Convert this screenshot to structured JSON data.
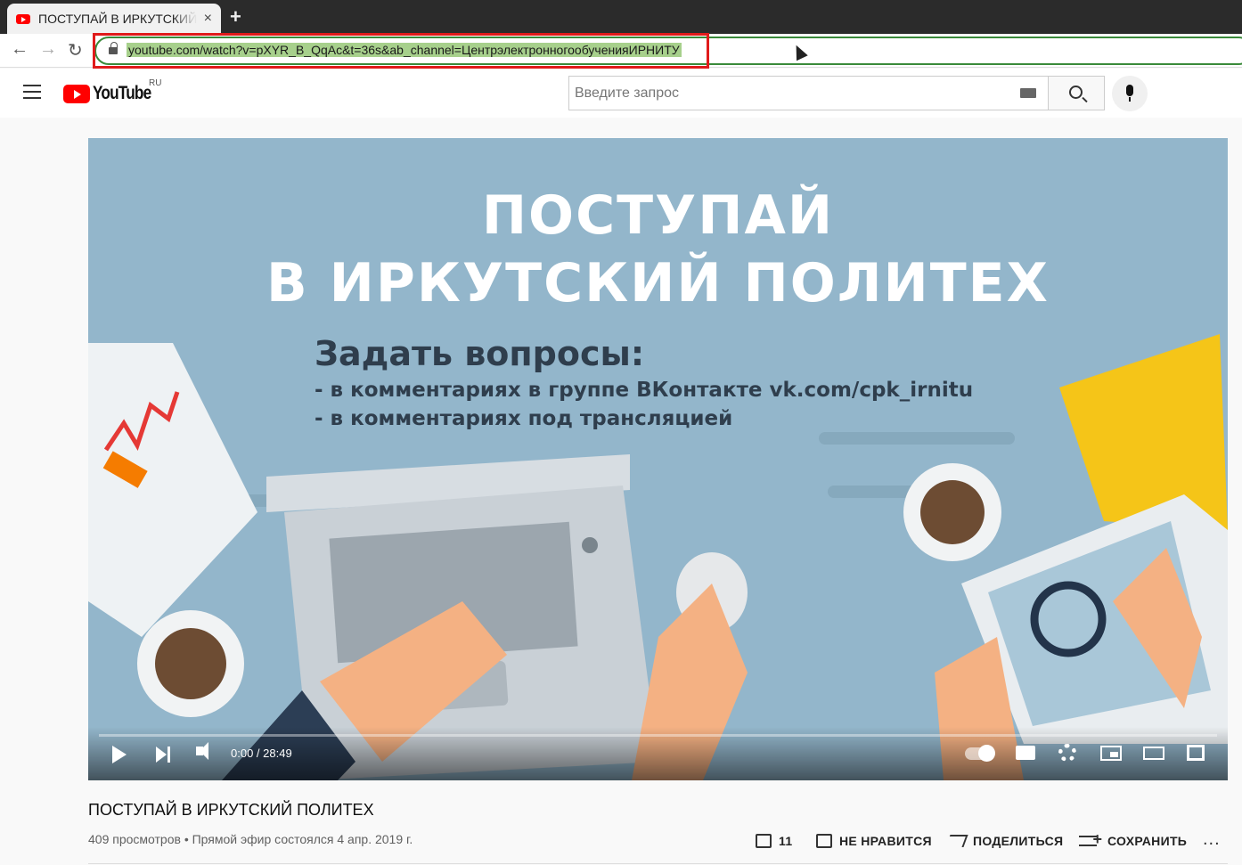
{
  "browser": {
    "tab_title": "ПОСТУПАЙ В ИРКУТСКИЙ ПОЛИТЕХ",
    "tab_close": "×",
    "new_tab": "+",
    "url": "youtube.com/watch?v=pXYR_B_QqAc&t=36s&ab_channel=ЦентрэлектронногообученияИРНИТУ",
    "back": "←",
    "forward": "→",
    "reload": "↻"
  },
  "header": {
    "logo_text": "YouTube",
    "region": "RU",
    "search_placeholder": "Введите запрос"
  },
  "video": {
    "overlay_title_1": "ПОСТУПАЙ",
    "overlay_title_2": "В ИРКУТСКИЙ ПОЛИТЕХ",
    "overlay_ask": "Задать вопросы:",
    "overlay_line_1": "- в комментариях в группе ВКонтакте vk.com/cpk_irnitu",
    "overlay_line_2": "- в комментариях под трансляцией",
    "time": "0:00 / 28:49",
    "progress_fraction": 0.0
  },
  "info": {
    "title": "ПОСТУПАЙ В ИРКУТСКИЙ ПОЛИТЕХ",
    "meta": "409 просмотров • Прямой эфир состоялся 4 апр. 2019 г.",
    "likes": "11",
    "dislike_label": "НЕ НРАВИТСЯ",
    "share_label": "ПОДЕЛИТЬСЯ",
    "save_label": "СОХРАНИТЬ",
    "more": "..."
  },
  "colors": {
    "youtube_red": "#ff0000",
    "highlight_box": "#e01b1b",
    "video_bg": "#8fb3c8"
  }
}
